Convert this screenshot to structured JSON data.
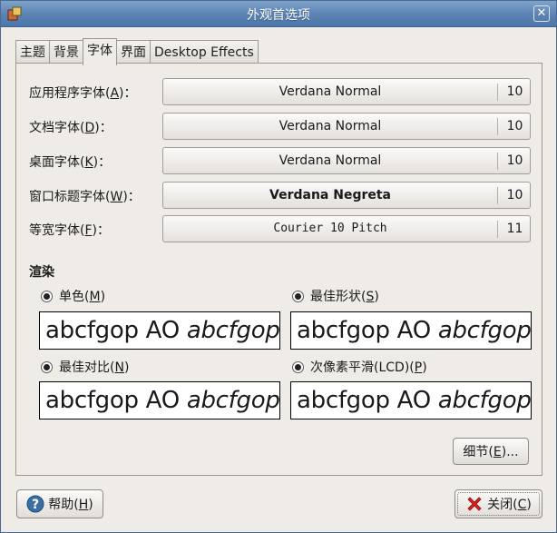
{
  "window": {
    "title": "外观首选项",
    "close_symbol": "✕"
  },
  "tabs": [
    {
      "label": "主题",
      "active": false
    },
    {
      "label": "背景",
      "active": false
    },
    {
      "label": "字体",
      "active": true
    },
    {
      "label": "界面",
      "active": false
    },
    {
      "label": "Desktop Effects",
      "active": false
    }
  ],
  "fonts": [
    {
      "label_pre": "应用程序字体(",
      "mnemonic": "A",
      "label_post": ")：",
      "font": "Verdana Normal",
      "size": "10"
    },
    {
      "label_pre": "文档字体(",
      "mnemonic": "D",
      "label_post": ")：",
      "font": "Verdana Normal",
      "size": "10"
    },
    {
      "label_pre": "桌面字体(",
      "mnemonic": "K",
      "label_post": ")：",
      "font": "Verdana Normal",
      "size": "10"
    },
    {
      "label_pre": "窗口标题字体(",
      "mnemonic": "W",
      "label_post": ")：",
      "font": "Verdana Negreta",
      "size": "10"
    },
    {
      "label_pre": "等宽字体(",
      "mnemonic": "F",
      "label_post": ")：",
      "font": "Courier 10 Pitch",
      "size": "11"
    }
  ],
  "rendering": {
    "title": "渲染",
    "options": [
      {
        "pre": "单色(",
        "mnemonic": "M",
        "post": ")"
      },
      {
        "pre": "最佳形状(",
        "mnemonic": "S",
        "post": ")"
      },
      {
        "pre": "最佳对比(",
        "mnemonic": "N",
        "post": ")"
      },
      {
        "pre": "次像素平滑(LCD)(",
        "mnemonic": "P",
        "post": ")"
      }
    ],
    "sample_regular": "abcfgop AO ",
    "sample_italic": "abcfgop"
  },
  "details_button": {
    "pre": "细节(",
    "mnemonic": "E",
    "post": ")..."
  },
  "help_button": {
    "pre": "帮助(",
    "mnemonic": "H",
    "post": ")"
  },
  "close_button": {
    "pre": "关闭(",
    "mnemonic": "C",
    "post": ")"
  },
  "colors": {
    "titlebar": "#5a82b3",
    "dialog_bg": "#efebe7",
    "close_icon": "#d61f1f",
    "help_icon": "#3a6ea5"
  }
}
